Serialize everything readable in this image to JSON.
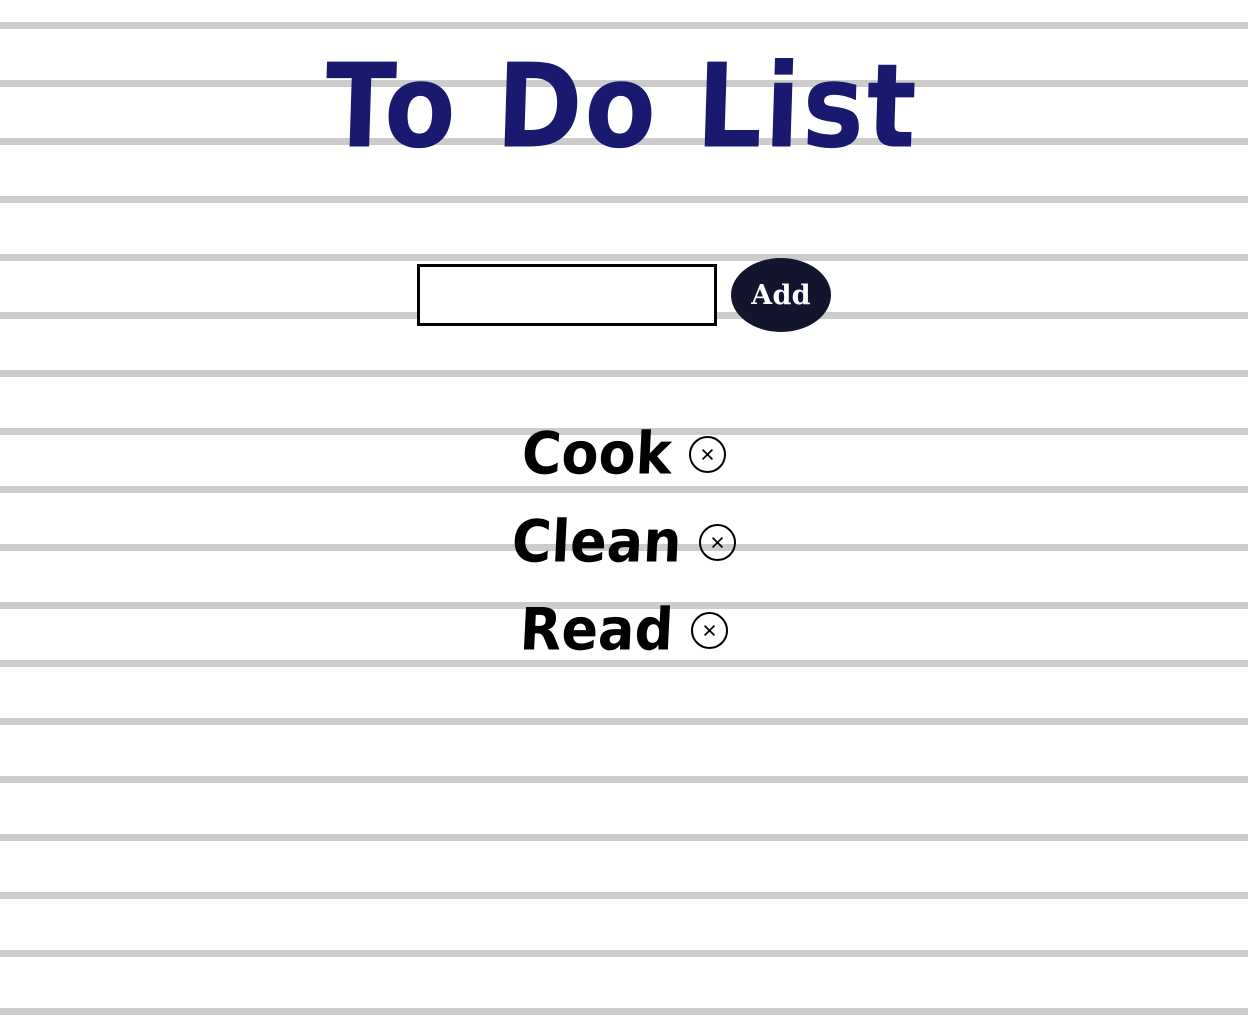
{
  "page": {
    "title": "To Do List",
    "title_color": "#191970",
    "paper_line_color": "#cccccc",
    "background_color": "#ffffff"
  },
  "add_form": {
    "input_value": "",
    "input_placeholder": "",
    "add_label": "Add",
    "button_color": "#13142e",
    "button_text_color": "#ffffff"
  },
  "todos": [
    {
      "label": "Cook",
      "delete_icon": "close-circle-icon",
      "delete_glyph": "×"
    },
    {
      "label": "Clean",
      "delete_icon": "close-circle-icon",
      "delete_glyph": "×"
    },
    {
      "label": "Read",
      "delete_icon": "close-circle-icon",
      "delete_glyph": "×"
    }
  ]
}
